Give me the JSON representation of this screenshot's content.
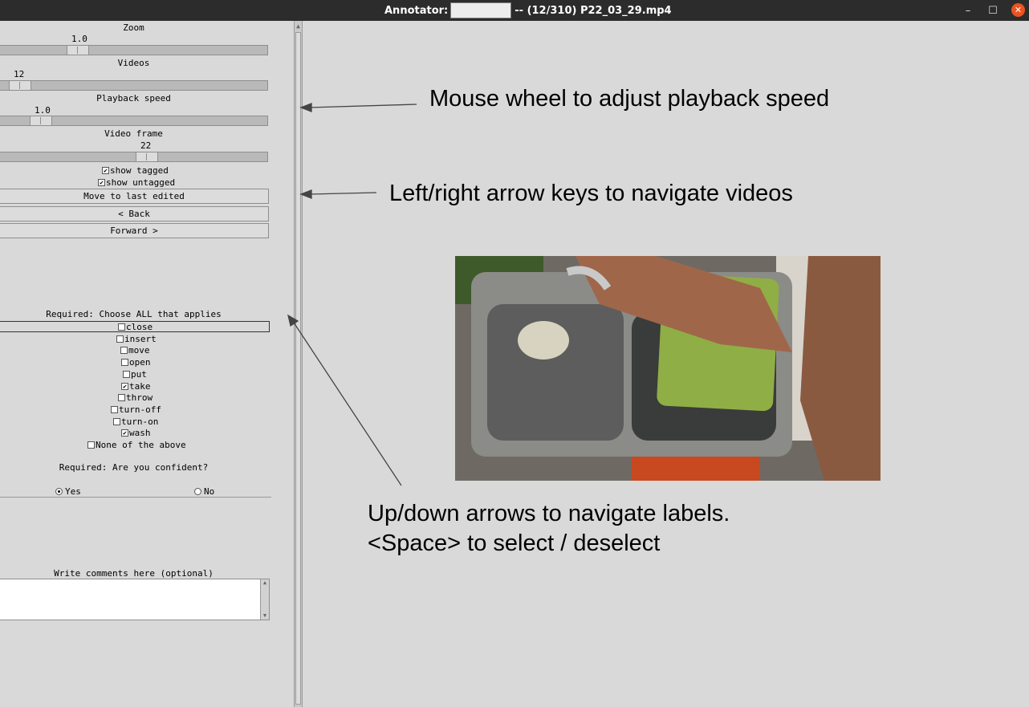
{
  "window": {
    "title_label": "Annotator:",
    "annotator_value": "",
    "title_suffix": "-- (12/310) P22_03_29.mp4",
    "minimize_glyph": "–",
    "maximize_glyph": "☐",
    "close_glyph": "✕"
  },
  "controls": {
    "zoom": {
      "label": "Zoom",
      "value": "1.0",
      "fraction": 0.27
    },
    "videos": {
      "label": "Videos",
      "value": "12",
      "fraction": 0.035
    },
    "playback": {
      "label": "Playback speed",
      "value": "1.0",
      "fraction": 0.12
    },
    "frame": {
      "label": "Video frame",
      "value": "22",
      "fraction": 0.55
    },
    "show_tagged": {
      "label": "show tagged",
      "checked": true
    },
    "show_untagged": {
      "label": "show untagged",
      "checked": true
    },
    "move_last_label": "Move to last edited",
    "back_label": "< Back",
    "forward_label": "Forward >"
  },
  "labels": {
    "heading": "Required: Choose ALL that applies",
    "items": [
      {
        "label": "close",
        "checked": false
      },
      {
        "label": "insert",
        "checked": false
      },
      {
        "label": "move",
        "checked": false
      },
      {
        "label": "open",
        "checked": false
      },
      {
        "label": "put",
        "checked": false
      },
      {
        "label": "take",
        "checked": true
      },
      {
        "label": "throw",
        "checked": false
      },
      {
        "label": "turn-off",
        "checked": false
      },
      {
        "label": "turn-on",
        "checked": false
      },
      {
        "label": "wash",
        "checked": true
      },
      {
        "label": "None of the above",
        "checked": false
      }
    ]
  },
  "confidence": {
    "heading": "Required: Are you confident?",
    "yes_label": "Yes",
    "no_label": "No",
    "selected": "Yes"
  },
  "comments": {
    "heading": "Write comments here (optional)",
    "value": ""
  },
  "hints": {
    "mouse_wheel": "Mouse wheel to adjust playback speed",
    "arrow_keys": "Left/right arrow keys to navigate videos",
    "updown_line1": "Up/down arrows to navigate labels.",
    "updown_line2": "<Space> to select / deselect"
  },
  "icons": {
    "check_mark": "✔",
    "scroll_up": "▲",
    "scroll_down": "▼"
  }
}
